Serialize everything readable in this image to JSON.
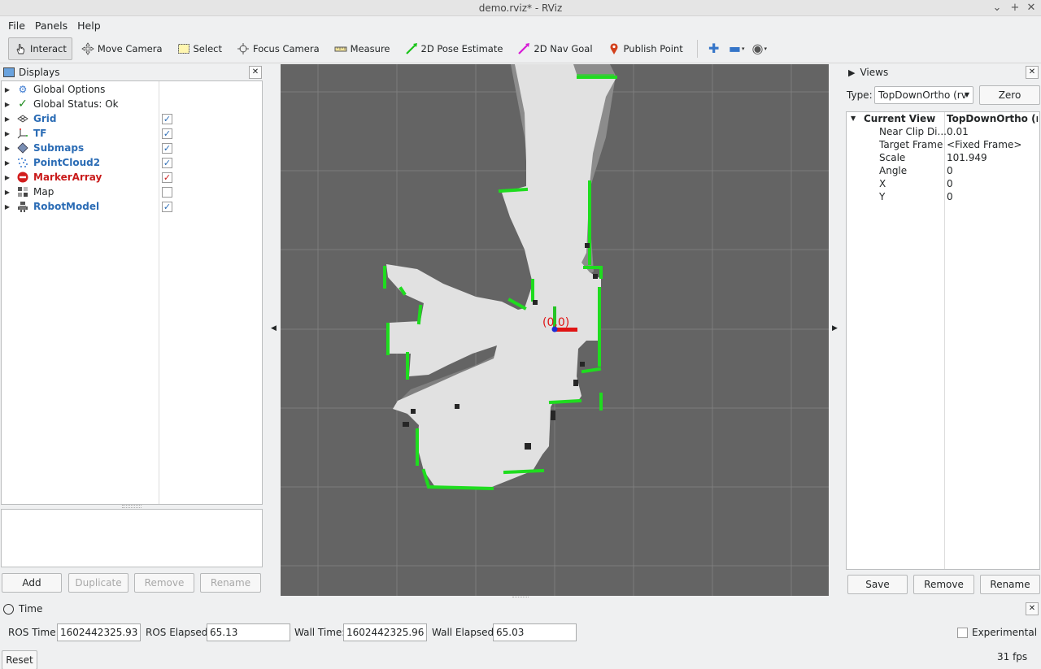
{
  "window": {
    "title": "demo.rviz* - RViz"
  },
  "menu": {
    "file": "File",
    "panels": "Panels",
    "help": "Help"
  },
  "toolbar": {
    "interact": "Interact",
    "move_camera": "Move Camera",
    "select": "Select",
    "focus_camera": "Focus Camera",
    "measure": "Measure",
    "pose_estimate": "2D Pose Estimate",
    "nav_goal": "2D Nav Goal",
    "publish_point": "Publish Point"
  },
  "displays": {
    "title": "Displays",
    "items": [
      {
        "label": "Global Options",
        "icon": "gear-icon",
        "style": "normal"
      },
      {
        "label": "Global Status: Ok",
        "icon": "checkmark-icon",
        "style": "normal"
      },
      {
        "label": "Grid",
        "icon": "grid-icon",
        "style": "blue",
        "checked": true
      },
      {
        "label": "TF",
        "icon": "tf-axes-icon",
        "style": "blue",
        "checked": true
      },
      {
        "label": "Submaps",
        "icon": "submaps-icon",
        "style": "blue",
        "checked": true
      },
      {
        "label": "PointCloud2",
        "icon": "pointcloud-icon",
        "style": "blue",
        "checked": true
      },
      {
        "label": "MarkerArray",
        "icon": "marker-error-icon",
        "style": "red",
        "checked": true
      },
      {
        "label": "Map",
        "icon": "map-icon",
        "style": "normal",
        "checked": false
      },
      {
        "label": "RobotModel",
        "icon": "robot-icon",
        "style": "blue",
        "checked": true
      }
    ],
    "buttons": {
      "add": "Add",
      "duplicate": "Duplicate",
      "remove": "Remove",
      "rename": "Rename"
    }
  },
  "viewport": {
    "origin_label": "(0,0)"
  },
  "views": {
    "title": "Views",
    "type_label": "Type:",
    "type_value": "TopDownOrtho (rv",
    "zero_button": "Zero",
    "current_view_key": "Current View",
    "current_view_value": "TopDownOrtho (rv...",
    "props": [
      {
        "key": "Near Clip Di...",
        "value": "0.01"
      },
      {
        "key": "Target Frame",
        "value": "<Fixed Frame>"
      },
      {
        "key": "Scale",
        "value": "101.949"
      },
      {
        "key": "Angle",
        "value": "0"
      },
      {
        "key": "X",
        "value": "0"
      },
      {
        "key": "Y",
        "value": "0"
      }
    ],
    "buttons": {
      "save": "Save",
      "remove": "Remove",
      "rename": "Rename"
    }
  },
  "time": {
    "title": "Time",
    "ros_time_label": "ROS Time:",
    "ros_time": "1602442325.93",
    "ros_elapsed_label": "ROS Elapsed:",
    "ros_elapsed": "65.13",
    "wall_time_label": "Wall Time:",
    "wall_time": "1602442325.96",
    "wall_elapsed_label": "Wall Elapsed:",
    "wall_elapsed": "65.03",
    "experimental_label": "Experimental",
    "reset_button": "Reset",
    "fps": "31 fps"
  },
  "colors": {
    "accent": "#2b6cb5",
    "error": "#c91b1b",
    "scan": "#1fdc1f",
    "background": "#646464"
  }
}
